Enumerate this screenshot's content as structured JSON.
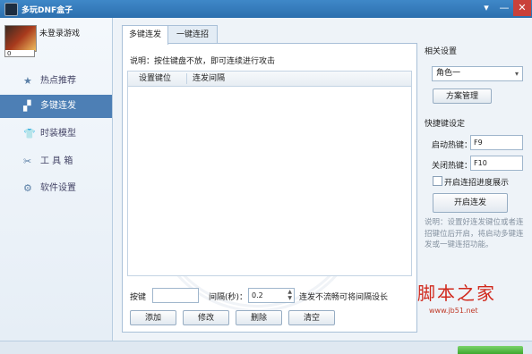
{
  "window": {
    "title": "多玩DNF盒子",
    "menu_glyph": "▾",
    "minimize_glyph": "—",
    "close_glyph": "✕"
  },
  "user": {
    "name": "未登录游戏",
    "level": "0"
  },
  "nav": [
    {
      "icon": "star-icon",
      "glyph": "★",
      "label": "热点推荐"
    },
    {
      "icon": "apps-icon",
      "glyph": "▞",
      "label": "多键连发"
    },
    {
      "icon": "shirt-icon",
      "glyph": "👕",
      "label": "时装模型"
    },
    {
      "icon": "tools-icon",
      "glyph": "✂",
      "label": "工 具 箱"
    },
    {
      "icon": "gear-icon",
      "glyph": "⚙",
      "label": "软件设置"
    }
  ],
  "tabs": [
    "多键连发",
    "一键连招"
  ],
  "panel": {
    "description": "说明：按住键盘不放，即可连续进行攻击",
    "columns": [
      "设置键位",
      "连发间隔"
    ],
    "key_label": "按键",
    "key_value": "",
    "interval_label": "间隔(秒)：",
    "interval_value": "0.2",
    "note": "连发不流畅可将间隔设长",
    "buttons": [
      "添加",
      "修改",
      "删除",
      "清空"
    ]
  },
  "settings": {
    "heading": "相关设置",
    "profile": "角色一",
    "dropdown_glyph": "▾",
    "manage_button": "方案管理",
    "hotkey_heading": "快捷键设定",
    "start_label": "启动热键：",
    "start_value": "F9",
    "stop_label": "关闭热键：",
    "stop_value": "F10",
    "progress_label": "开启连招进度展示",
    "progress_checked": false,
    "start_button": "开启连发",
    "help": "说明：设置好连发键位或者连招键位后开启，将启动多键连发或一键连招功能。"
  },
  "watermark": {
    "text": "脚本之家",
    "url": "www.jb51.net"
  }
}
